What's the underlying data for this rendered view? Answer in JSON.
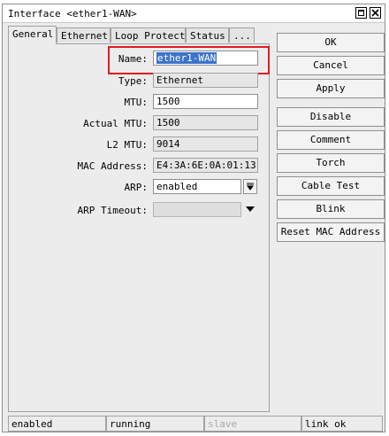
{
  "window": {
    "title": "Interface <ether1-WAN>"
  },
  "tabs": [
    {
      "label": "General"
    },
    {
      "label": "Ethernet"
    },
    {
      "label": "Loop Protect"
    },
    {
      "label": "Status"
    },
    {
      "label": "..."
    }
  ],
  "form": {
    "name": {
      "label": "Name:",
      "value": "ether1-WAN"
    },
    "type": {
      "label": "Type:",
      "value": "Ethernet"
    },
    "mtu": {
      "label": "MTU:",
      "value": "1500"
    },
    "actual_mtu": {
      "label": "Actual MTU:",
      "value": "1500"
    },
    "l2_mtu": {
      "label": "L2 MTU:",
      "value": "9014"
    },
    "mac_address": {
      "label": "MAC Address:",
      "value": "E4:3A:6E:0A:01:13"
    },
    "arp": {
      "label": "ARP:",
      "value": "enabled"
    },
    "arp_timeout": {
      "label": "ARP Timeout:",
      "value": ""
    }
  },
  "buttons": [
    {
      "label": "OK"
    },
    {
      "label": "Cancel"
    },
    {
      "label": "Apply"
    },
    {
      "label": "Disable"
    },
    {
      "label": "Comment"
    },
    {
      "label": "Torch"
    },
    {
      "label": "Cable Test"
    },
    {
      "label": "Blink"
    },
    {
      "label": "Reset MAC Address"
    }
  ],
  "status_bar": [
    "enabled",
    "running",
    "slave",
    "link ok"
  ],
  "icons": {
    "maximize": "maximize-icon",
    "close": "close-icon",
    "dropdown": "dropdown-arrow-icon"
  },
  "colors": {
    "selection": "#3b73c9",
    "highlight_border": "#e01b22"
  }
}
